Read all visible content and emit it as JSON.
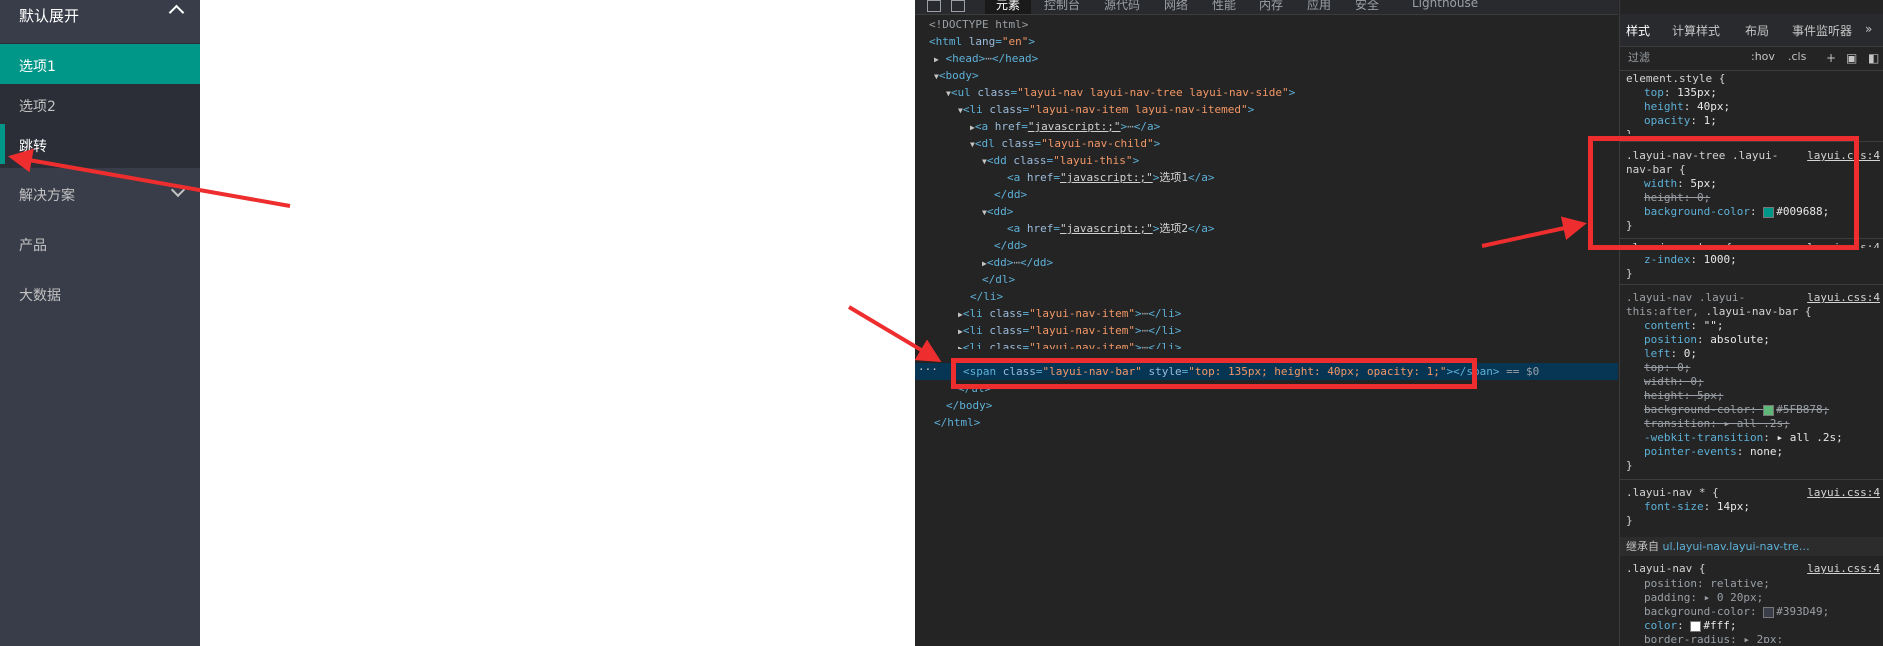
{
  "nav": {
    "top_item": "默认展开",
    "children": [
      "选项1",
      "选项2",
      "跳转"
    ],
    "items": [
      "解决方案",
      "产品",
      "大数据"
    ]
  },
  "devtools": {
    "tabs": [
      "元素",
      "控制台",
      "源代码",
      "网络",
      "性能",
      "内存",
      "应用",
      "安全",
      "Lighthouse"
    ],
    "dom_eq": "== $0",
    "styles_tabs": [
      "样式",
      "计算样式",
      "布局",
      "事件监听器",
      "»"
    ],
    "filter_placeholder": "过滤",
    "hov": ":hov",
    "cls": ".cls",
    "inherit_label": "继承自",
    "inherit_target": "ul.layui-nav.layui-nav-tre…"
  },
  "colors": {
    "nav_bg": "#393D49",
    "nav_child_bg": "#2B2E37",
    "accent": "#009688",
    "annotation": "#ee2e2e"
  }
}
